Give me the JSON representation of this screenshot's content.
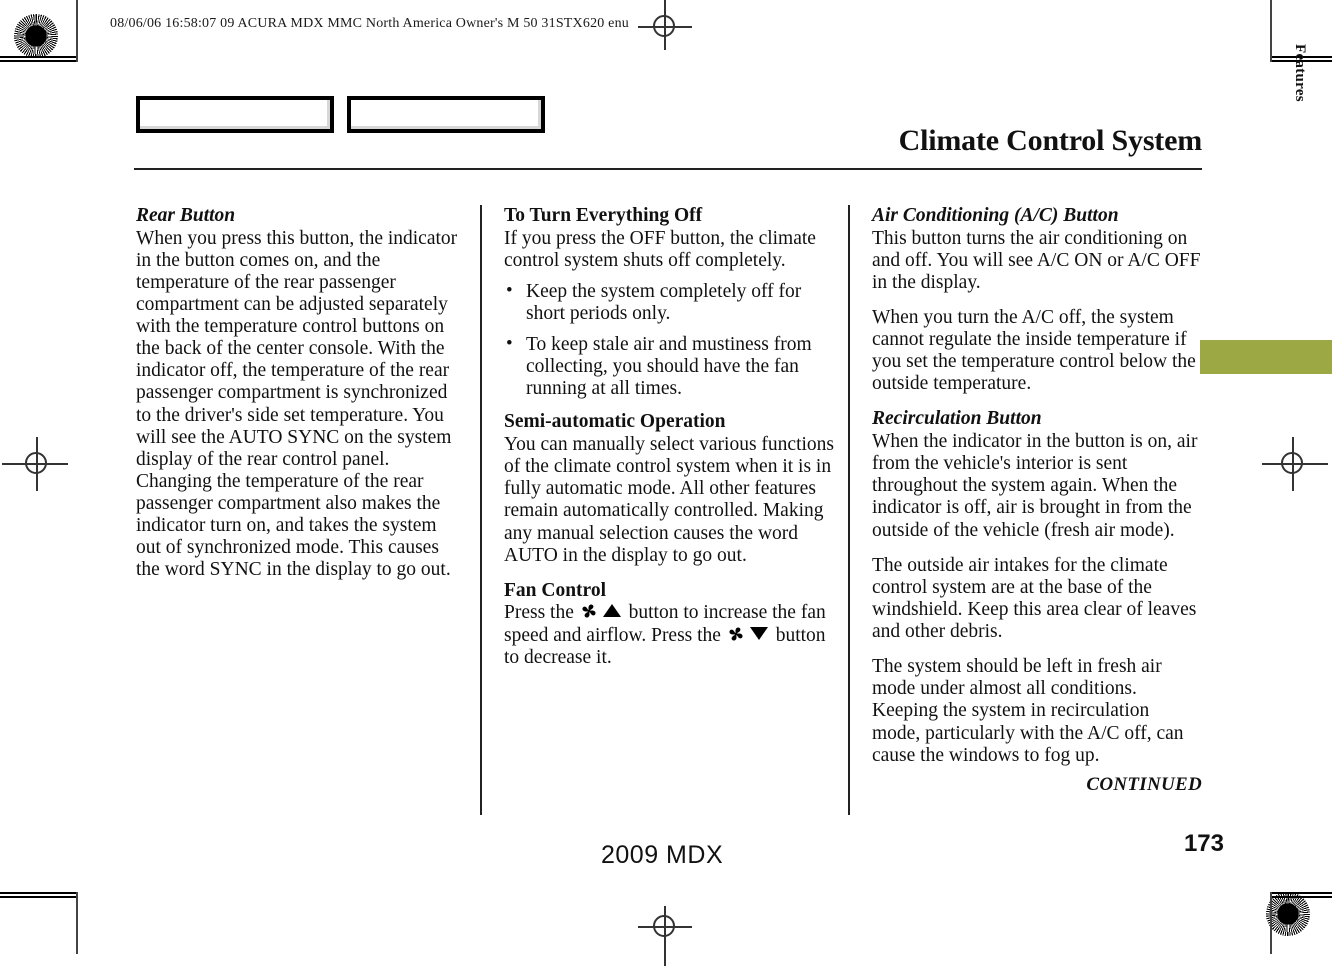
{
  "prepress": {
    "header_line": "08/06/06 16:58:07    09 ACURA MDX MMC North America Owner's M 50 31STX620 enu"
  },
  "page": {
    "chapter_title": "Climate Control System",
    "side_tab_label": "Features",
    "footer_model": "2009  MDX",
    "page_number": "173",
    "continued_label": "CONTINUED",
    "tab_color": "#9ca843"
  },
  "columns": {
    "col1": {
      "heading": "Rear Button",
      "paragraph": "When you press this button, the indicator in the button comes on, and the temperature of the rear passenger compartment can be adjusted separately with the temperature control buttons on the back of the center console. With the indicator off, the temperature of the rear passenger compartment is synchronized to the driver's side set temperature. You will see the AUTO SYNC on the system display of the rear control panel. Changing the temperature of the rear passenger compartment also makes the indicator turn on, and takes the system out of synchronized mode. This causes the word SYNC in the display to go out."
    },
    "col2": {
      "section1": {
        "heading": "To Turn Everything Off",
        "paragraph": "If you press the OFF button, the climate control system shuts off completely.",
        "bullets": [
          "Keep the system completely off for short periods only.",
          "To keep stale air and mustiness from collecting, you should have the fan running at all times."
        ]
      },
      "section2": {
        "heading": "Semi-automatic Operation",
        "paragraph": "You can manually select various functions of the climate control system when it is in fully automatic mode. All other features remain automatically controlled. Making any manual selection causes the word AUTO in the display to go out."
      },
      "section3": {
        "heading": "Fan Control",
        "text_part1": "Press the",
        "text_part2": "button to increase the fan speed and airflow. Press the",
        "text_part3": "button to decrease it."
      }
    },
    "col3": {
      "section1": {
        "heading": "Air Conditioning (A/C) Button",
        "paragraph1": "This button turns the air conditioning on and off. You will see A/C ON or A/C OFF in the display.",
        "paragraph2": "When you turn the A/C off, the system cannot regulate the inside temperature if you set the temperature control below the outside temperature."
      },
      "section2": {
        "heading": "Recirculation Button",
        "paragraph1": "When the indicator in the button is on, air from the vehicle's interior is sent throughout the system again. When the indicator is off, air is brought in from the outside of the vehicle (fresh air mode).",
        "paragraph2": "The outside air intakes for the climate control system are at the base of the windshield. Keep this area clear of leaves and other debris.",
        "paragraph3": "The system should be left in fresh air mode under almost all conditions. Keeping the system in recirculation mode, particularly with the A/C off, can cause the windows to fog up."
      }
    }
  }
}
